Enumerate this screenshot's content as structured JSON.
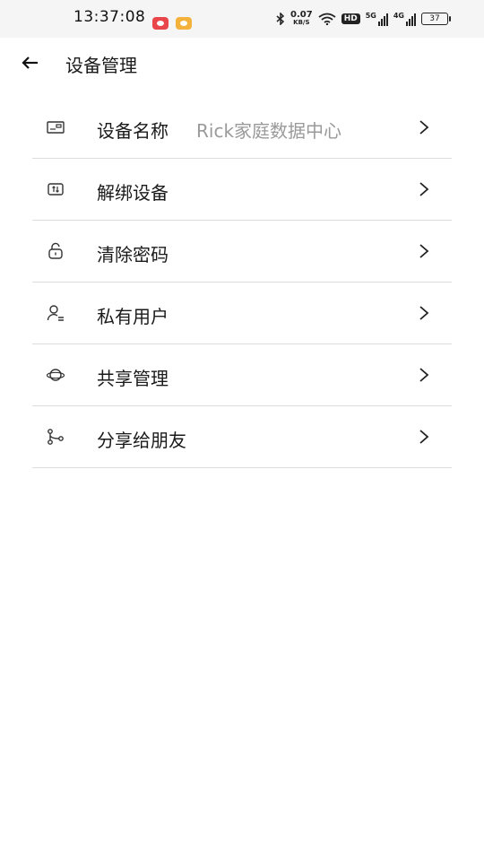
{
  "status_bar": {
    "time": "13:37:08",
    "speed_value": "0.07",
    "speed_unit": "KB/S",
    "hd": "HD",
    "sim1": "5G",
    "sim2": "4G",
    "battery": "37"
  },
  "header": {
    "title": "设备管理"
  },
  "menu": {
    "items": [
      {
        "label": "设备名称",
        "value": "Rick家庭数据中心",
        "icon": "device-card-icon"
      },
      {
        "label": "解绑设备",
        "icon": "unbind-icon"
      },
      {
        "label": "清除密码",
        "icon": "unlock-icon"
      },
      {
        "label": "私有用户",
        "icon": "private-user-icon"
      },
      {
        "label": "共享管理",
        "icon": "planet-icon"
      },
      {
        "label": "分享给朋友",
        "icon": "share-icon"
      }
    ]
  }
}
